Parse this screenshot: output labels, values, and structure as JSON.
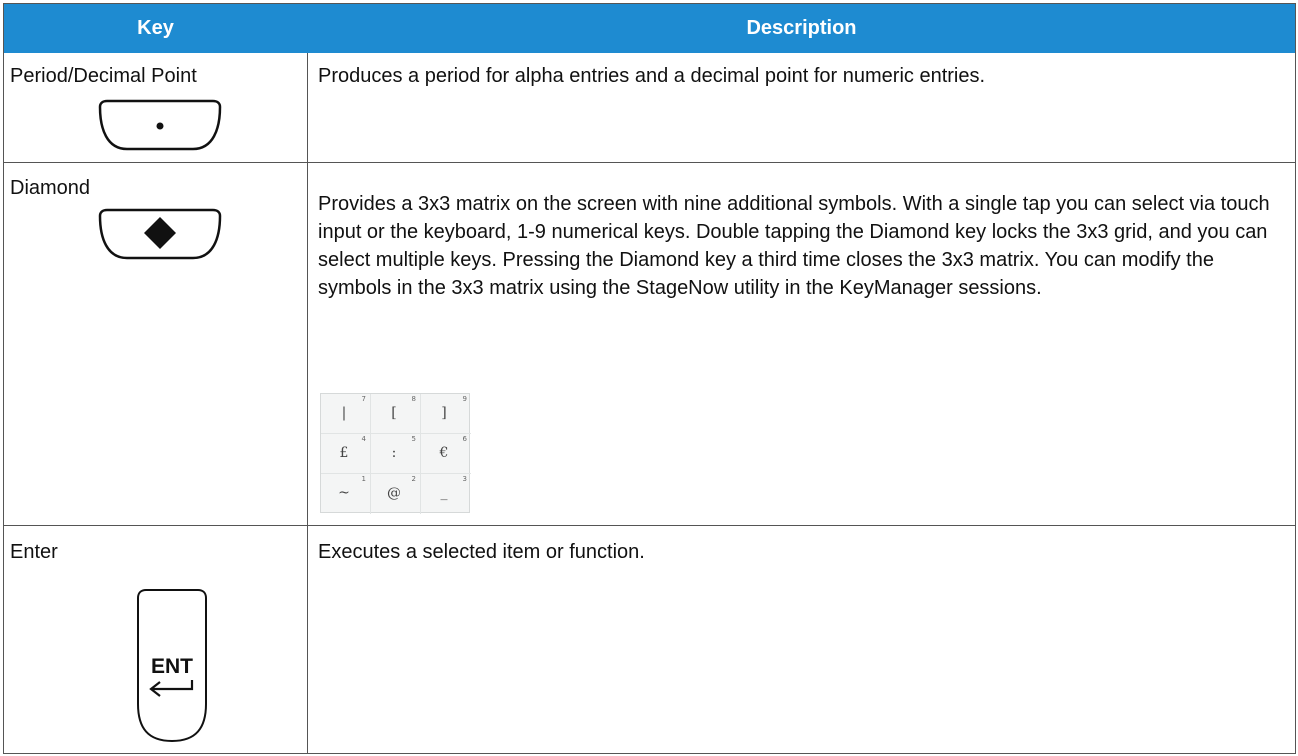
{
  "table": {
    "headers": {
      "key": "Key",
      "description": "Description"
    },
    "rows": [
      {
        "key": "Period/Decimal Point",
        "description": "Produces a period for alpha entries and a decimal point for numeric entries.",
        "key_icon": "period-key-icon"
      },
      {
        "key": "Diamond",
        "description": "Provides a 3x3 matrix on the screen with nine additional symbols. With a single tap you can select via touch input or the keyboard, 1-9 numerical keys. Double tapping the Diamond key locks the 3x3 grid, and you can select multiple keys. Pressing the Diamond key a third time closes the 3x3 matrix. You can modify the symbols in the 3x3 matrix using the StageNow utility in the KeyManager sessions.",
        "key_icon": "diamond-key-icon",
        "matrix": [
          {
            "symbol": "|",
            "number": "7"
          },
          {
            "symbol": "[",
            "number": "8"
          },
          {
            "symbol": "]",
            "number": "9"
          },
          {
            "symbol": "£",
            "number": "4"
          },
          {
            "symbol": ":",
            "number": "5"
          },
          {
            "symbol": "€",
            "number": "6"
          },
          {
            "symbol": "~",
            "number": "1"
          },
          {
            "symbol": "@",
            "number": "2"
          },
          {
            "symbol": "_",
            "number": "3"
          }
        ]
      },
      {
        "key": "Enter",
        "description": "Executes a selected item or function.",
        "key_icon": "enter-key-icon",
        "key_label": "ENT"
      }
    ]
  },
  "colors": {
    "header_bg": "#1e8bd1",
    "header_text": "#ffffff",
    "border": "#555555"
  }
}
